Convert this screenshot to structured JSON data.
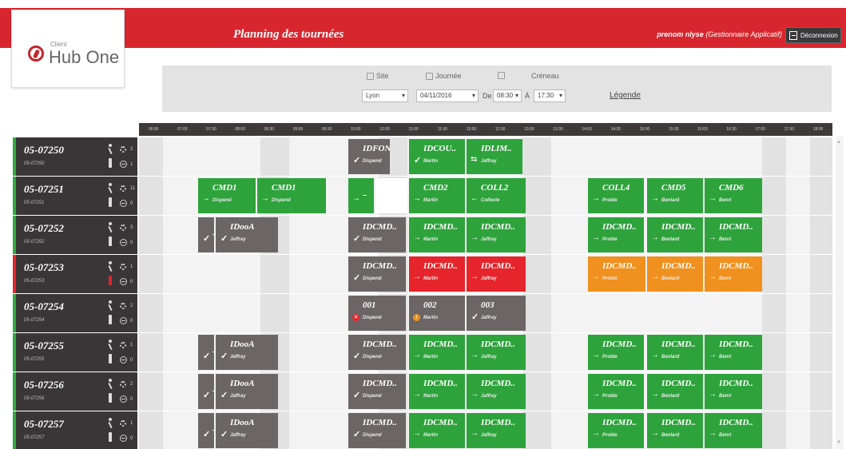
{
  "logo": {
    "small": "Client",
    "text": "Hub One"
  },
  "header": {
    "title": "Planning des tournées",
    "user_name": "prenom nlyse",
    "user_role": "(Gestionnaire Applicatif)",
    "logout_label": "Déconnexion"
  },
  "filters": {
    "site_label": "Site",
    "journee_label": "Journée",
    "creneau_label": "Créneau",
    "site_value": "Lyon",
    "date_value": "04/11/2016",
    "from_label": "De",
    "from_value": "08:30",
    "to_label": "À",
    "to_value": "17:30",
    "legend_label": "Légende"
  },
  "timeline": [
    "06:00",
    "07:00",
    "07:30",
    "08:00",
    "08:30",
    "09:00",
    "09:30",
    "10:00",
    "10:30",
    "11:00",
    "11:30",
    "12:00",
    "12:30",
    "13:00",
    "13:30",
    "14:00",
    "14:30",
    "15:00",
    "15:30",
    "16:00",
    "16:30",
    "17:00",
    "17:30",
    "18:00"
  ],
  "rows": [
    {
      "id": "05-07250",
      "sub": "05-07250",
      "count1": "2",
      "count2": "1",
      "alert": false,
      "tasks": [
        {
          "name": "IDFON..",
          "sub": "Dispend",
          "color": "gray",
          "icon": "check"
        },
        {
          "name": "IDCOU..",
          "sub": "Martin",
          "color": "green",
          "icon": "check"
        },
        {
          "name": "IDLIM..",
          "sub": "Jaffray",
          "color": "green",
          "icon": "left-right"
        }
      ]
    },
    {
      "id": "05-07251",
      "sub": "05-07251",
      "count1": "11",
      "count2": "0",
      "alert": false,
      "tasks": [
        {
          "name": "CMD1",
          "sub": "Dispend",
          "color": "green",
          "icon": "arrow"
        },
        {
          "name": "CMD1",
          "sub": "Dispend",
          "color": "green",
          "icon": "arrow"
        },
        {
          "name": "",
          "sub": "",
          "color": "green",
          "icon": "arrow-dash"
        },
        {
          "name": "CMD2",
          "sub": "Martin",
          "color": "green",
          "icon": "arrow"
        },
        {
          "name": "COLL2",
          "sub": "Collecte",
          "color": "green",
          "icon": "left"
        },
        {
          "name": "COLL4",
          "sub": "Proble",
          "color": "green",
          "icon": "arrow"
        },
        {
          "name": "CMD5",
          "sub": "Benlard",
          "color": "green",
          "icon": "arrow"
        },
        {
          "name": "CMD6",
          "sub": "Benri",
          "color": "green",
          "icon": "arrow"
        }
      ]
    },
    {
      "id": "05-07252",
      "sub": "05-07252",
      "count1": "3",
      "count2": "0",
      "alert": false,
      "tasks": [
        {
          "name": "",
          "sub": "",
          "color": "gray",
          "icon": "check-dash"
        },
        {
          "name": "IDooA",
          "sub": "Jaffray",
          "color": "gray",
          "icon": "check"
        },
        {
          "name": "IDCMD..",
          "sub": "Dispend",
          "color": "gray",
          "icon": "check"
        },
        {
          "name": "IDCMD..",
          "sub": "Martin",
          "color": "green",
          "icon": "arrow"
        },
        {
          "name": "IDCMD..",
          "sub": "Jaffray",
          "color": "green",
          "icon": "arrow"
        },
        {
          "name": "IDCMD..",
          "sub": "Proble",
          "color": "green",
          "icon": "arrow"
        },
        {
          "name": "IDCMD..",
          "sub": "Benlard",
          "color": "green",
          "icon": "arrow"
        },
        {
          "name": "IDCMD..",
          "sub": "Benri",
          "color": "green",
          "icon": "arrow"
        }
      ]
    },
    {
      "id": "05-07253",
      "sub": "05-07253",
      "count1": "1",
      "count2": "0",
      "alert": true,
      "tasks": [
        {
          "name": "IDCMD..",
          "sub": "Dispend",
          "color": "gray",
          "icon": "check"
        },
        {
          "name": "IDCMD..",
          "sub": "Martin",
          "color": "red",
          "icon": "arrow"
        },
        {
          "name": "IDCMD..",
          "sub": "Jaffray",
          "color": "red",
          "icon": "arrow"
        },
        {
          "name": "IDCMD..",
          "sub": "Proble",
          "color": "orange",
          "icon": "arrow"
        },
        {
          "name": "IDCMD..",
          "sub": "Benlard",
          "color": "orange",
          "icon": "arrow"
        },
        {
          "name": "IDCMD..",
          "sub": "Benri",
          "color": "orange",
          "icon": "arrow"
        }
      ]
    },
    {
      "id": "05-07254",
      "sub": "05-07254",
      "count1": "2",
      "count2": "0",
      "alert": false,
      "tasks": [
        {
          "name": "001",
          "sub": "Dispend",
          "color": "gray",
          "icon": "error"
        },
        {
          "name": "002",
          "sub": "Martin",
          "color": "gray",
          "icon": "warning"
        },
        {
          "name": "003",
          "sub": "Jaffray",
          "color": "gray",
          "icon": "check"
        }
      ]
    },
    {
      "id": "05-07255",
      "sub": "05-07255",
      "count1": "1",
      "count2": "0",
      "alert": false,
      "tasks": [
        {
          "name": "",
          "sub": "",
          "color": "gray",
          "icon": "check-dash"
        },
        {
          "name": "IDooA",
          "sub": "Jaffray",
          "color": "gray",
          "icon": "check"
        },
        {
          "name": "IDCMD..",
          "sub": "Dispend",
          "color": "gray",
          "icon": "check"
        },
        {
          "name": "IDCMD..",
          "sub": "Martin",
          "color": "green",
          "icon": "arrow"
        },
        {
          "name": "IDCMD..",
          "sub": "Jaffray",
          "color": "green",
          "icon": "arrow"
        },
        {
          "name": "IDCMD..",
          "sub": "Proble",
          "color": "green",
          "icon": "arrow"
        },
        {
          "name": "IDCMD..",
          "sub": "Benlard",
          "color": "green",
          "icon": "arrow"
        },
        {
          "name": "IDCMD..",
          "sub": "Benri",
          "color": "green",
          "icon": "arrow"
        }
      ]
    },
    {
      "id": "05-07256",
      "sub": "05-07256",
      "count1": "2",
      "count2": "0",
      "alert": false,
      "tasks": [
        {
          "name": "",
          "sub": "",
          "color": "gray",
          "icon": "check-dash"
        },
        {
          "name": "IDooA",
          "sub": "Jaffray",
          "color": "gray",
          "icon": "check"
        },
        {
          "name": "IDCMD..",
          "sub": "Dispend",
          "color": "gray",
          "icon": "check"
        },
        {
          "name": "IDCMD..",
          "sub": "Martin",
          "color": "green",
          "icon": "arrow"
        },
        {
          "name": "IDCMD..",
          "sub": "Jaffray",
          "color": "green",
          "icon": "arrow"
        },
        {
          "name": "IDCMD..",
          "sub": "Proble",
          "color": "green",
          "icon": "arrow"
        },
        {
          "name": "IDCMD..",
          "sub": "Benlard",
          "color": "green",
          "icon": "arrow"
        },
        {
          "name": "IDCMD..",
          "sub": "Benri",
          "color": "green",
          "icon": "arrow"
        }
      ]
    },
    {
      "id": "05-07257",
      "sub": "05-07257",
      "count1": "1",
      "count2": "0",
      "alert": false,
      "tasks": [
        {
          "name": "",
          "sub": "",
          "color": "gray",
          "icon": "check-dash"
        },
        {
          "name": "IDooA",
          "sub": "Jaffray",
          "color": "gray",
          "icon": "check"
        },
        {
          "name": "IDCMD..",
          "sub": "Dispend",
          "color": "gray",
          "icon": "check"
        },
        {
          "name": "IDCMD..",
          "sub": "Martin",
          "color": "green",
          "icon": "arrow"
        },
        {
          "name": "IDCMD..",
          "sub": "Jaffray",
          "color": "green",
          "icon": "arrow"
        },
        {
          "name": "IDCMD..",
          "sub": "Proble",
          "color": "green",
          "icon": "arrow"
        },
        {
          "name": "IDCMD..",
          "sub": "Benlard",
          "color": "green",
          "icon": "arrow"
        },
        {
          "name": "IDCMD..",
          "sub": "Benri",
          "color": "green",
          "icon": "arrow"
        }
      ]
    }
  ],
  "colors": {
    "brand": "#d8262e",
    "done": "#2ea33c",
    "pending": "#6b6565",
    "late": "#e5242b",
    "warning": "#f0901e"
  }
}
